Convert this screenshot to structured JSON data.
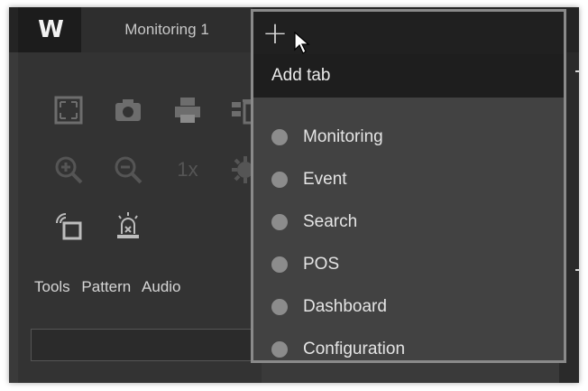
{
  "app": {
    "logo_text": "W"
  },
  "tabs": [
    {
      "label": "Monitoring 1"
    }
  ],
  "add_tab_button": {
    "icon": "plus-icon"
  },
  "popup": {
    "header": "Add tab",
    "items": [
      {
        "label": "Monitoring"
      },
      {
        "label": "Event"
      },
      {
        "label": "Search"
      },
      {
        "label": "POS"
      },
      {
        "label": "Dashboard"
      },
      {
        "label": "Configuration"
      }
    ]
  },
  "toolbar": {
    "icons": [
      "fullscreen-icon",
      "snapshot-icon",
      "print-icon",
      "delete-icon",
      "zoom-in-icon",
      "zoom-out-icon",
      "original-size-icon",
      "settings-icon",
      "layer-icon",
      "alarm-icon"
    ],
    "zoom_label": "1x"
  },
  "panel_tabs": [
    "Tools",
    "Pattern",
    "Audio"
  ],
  "colors": {
    "background": "#3a3a3a",
    "tabbar": "#242424",
    "popup": "#424242",
    "popup_border": "#8a8a8a",
    "dot": "#8c8c8c"
  }
}
